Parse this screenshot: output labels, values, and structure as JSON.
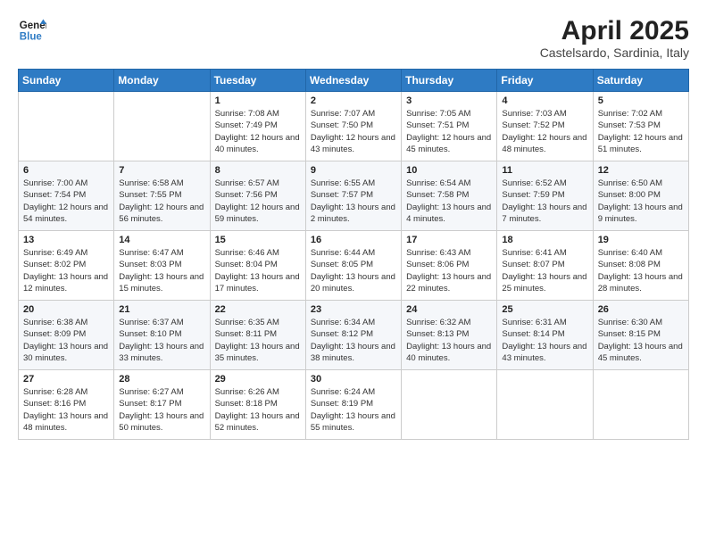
{
  "header": {
    "logo_line1": "General",
    "logo_line2": "Blue",
    "title": "April 2025",
    "subtitle": "Castelsardo, Sardinia, Italy"
  },
  "days_of_week": [
    "Sunday",
    "Monday",
    "Tuesday",
    "Wednesday",
    "Thursday",
    "Friday",
    "Saturday"
  ],
  "weeks": [
    [
      {
        "day": "",
        "detail": ""
      },
      {
        "day": "",
        "detail": ""
      },
      {
        "day": "1",
        "detail": "Sunrise: 7:08 AM\nSunset: 7:49 PM\nDaylight: 12 hours and 40 minutes."
      },
      {
        "day": "2",
        "detail": "Sunrise: 7:07 AM\nSunset: 7:50 PM\nDaylight: 12 hours and 43 minutes."
      },
      {
        "day": "3",
        "detail": "Sunrise: 7:05 AM\nSunset: 7:51 PM\nDaylight: 12 hours and 45 minutes."
      },
      {
        "day": "4",
        "detail": "Sunrise: 7:03 AM\nSunset: 7:52 PM\nDaylight: 12 hours and 48 minutes."
      },
      {
        "day": "5",
        "detail": "Sunrise: 7:02 AM\nSunset: 7:53 PM\nDaylight: 12 hours and 51 minutes."
      }
    ],
    [
      {
        "day": "6",
        "detail": "Sunrise: 7:00 AM\nSunset: 7:54 PM\nDaylight: 12 hours and 54 minutes."
      },
      {
        "day": "7",
        "detail": "Sunrise: 6:58 AM\nSunset: 7:55 PM\nDaylight: 12 hours and 56 minutes."
      },
      {
        "day": "8",
        "detail": "Sunrise: 6:57 AM\nSunset: 7:56 PM\nDaylight: 12 hours and 59 minutes."
      },
      {
        "day": "9",
        "detail": "Sunrise: 6:55 AM\nSunset: 7:57 PM\nDaylight: 13 hours and 2 minutes."
      },
      {
        "day": "10",
        "detail": "Sunrise: 6:54 AM\nSunset: 7:58 PM\nDaylight: 13 hours and 4 minutes."
      },
      {
        "day": "11",
        "detail": "Sunrise: 6:52 AM\nSunset: 7:59 PM\nDaylight: 13 hours and 7 minutes."
      },
      {
        "day": "12",
        "detail": "Sunrise: 6:50 AM\nSunset: 8:00 PM\nDaylight: 13 hours and 9 minutes."
      }
    ],
    [
      {
        "day": "13",
        "detail": "Sunrise: 6:49 AM\nSunset: 8:02 PM\nDaylight: 13 hours and 12 minutes."
      },
      {
        "day": "14",
        "detail": "Sunrise: 6:47 AM\nSunset: 8:03 PM\nDaylight: 13 hours and 15 minutes."
      },
      {
        "day": "15",
        "detail": "Sunrise: 6:46 AM\nSunset: 8:04 PM\nDaylight: 13 hours and 17 minutes."
      },
      {
        "day": "16",
        "detail": "Sunrise: 6:44 AM\nSunset: 8:05 PM\nDaylight: 13 hours and 20 minutes."
      },
      {
        "day": "17",
        "detail": "Sunrise: 6:43 AM\nSunset: 8:06 PM\nDaylight: 13 hours and 22 minutes."
      },
      {
        "day": "18",
        "detail": "Sunrise: 6:41 AM\nSunset: 8:07 PM\nDaylight: 13 hours and 25 minutes."
      },
      {
        "day": "19",
        "detail": "Sunrise: 6:40 AM\nSunset: 8:08 PM\nDaylight: 13 hours and 28 minutes."
      }
    ],
    [
      {
        "day": "20",
        "detail": "Sunrise: 6:38 AM\nSunset: 8:09 PM\nDaylight: 13 hours and 30 minutes."
      },
      {
        "day": "21",
        "detail": "Sunrise: 6:37 AM\nSunset: 8:10 PM\nDaylight: 13 hours and 33 minutes."
      },
      {
        "day": "22",
        "detail": "Sunrise: 6:35 AM\nSunset: 8:11 PM\nDaylight: 13 hours and 35 minutes."
      },
      {
        "day": "23",
        "detail": "Sunrise: 6:34 AM\nSunset: 8:12 PM\nDaylight: 13 hours and 38 minutes."
      },
      {
        "day": "24",
        "detail": "Sunrise: 6:32 AM\nSunset: 8:13 PM\nDaylight: 13 hours and 40 minutes."
      },
      {
        "day": "25",
        "detail": "Sunrise: 6:31 AM\nSunset: 8:14 PM\nDaylight: 13 hours and 43 minutes."
      },
      {
        "day": "26",
        "detail": "Sunrise: 6:30 AM\nSunset: 8:15 PM\nDaylight: 13 hours and 45 minutes."
      }
    ],
    [
      {
        "day": "27",
        "detail": "Sunrise: 6:28 AM\nSunset: 8:16 PM\nDaylight: 13 hours and 48 minutes."
      },
      {
        "day": "28",
        "detail": "Sunrise: 6:27 AM\nSunset: 8:17 PM\nDaylight: 13 hours and 50 minutes."
      },
      {
        "day": "29",
        "detail": "Sunrise: 6:26 AM\nSunset: 8:18 PM\nDaylight: 13 hours and 52 minutes."
      },
      {
        "day": "30",
        "detail": "Sunrise: 6:24 AM\nSunset: 8:19 PM\nDaylight: 13 hours and 55 minutes."
      },
      {
        "day": "",
        "detail": ""
      },
      {
        "day": "",
        "detail": ""
      },
      {
        "day": "",
        "detail": ""
      }
    ]
  ]
}
